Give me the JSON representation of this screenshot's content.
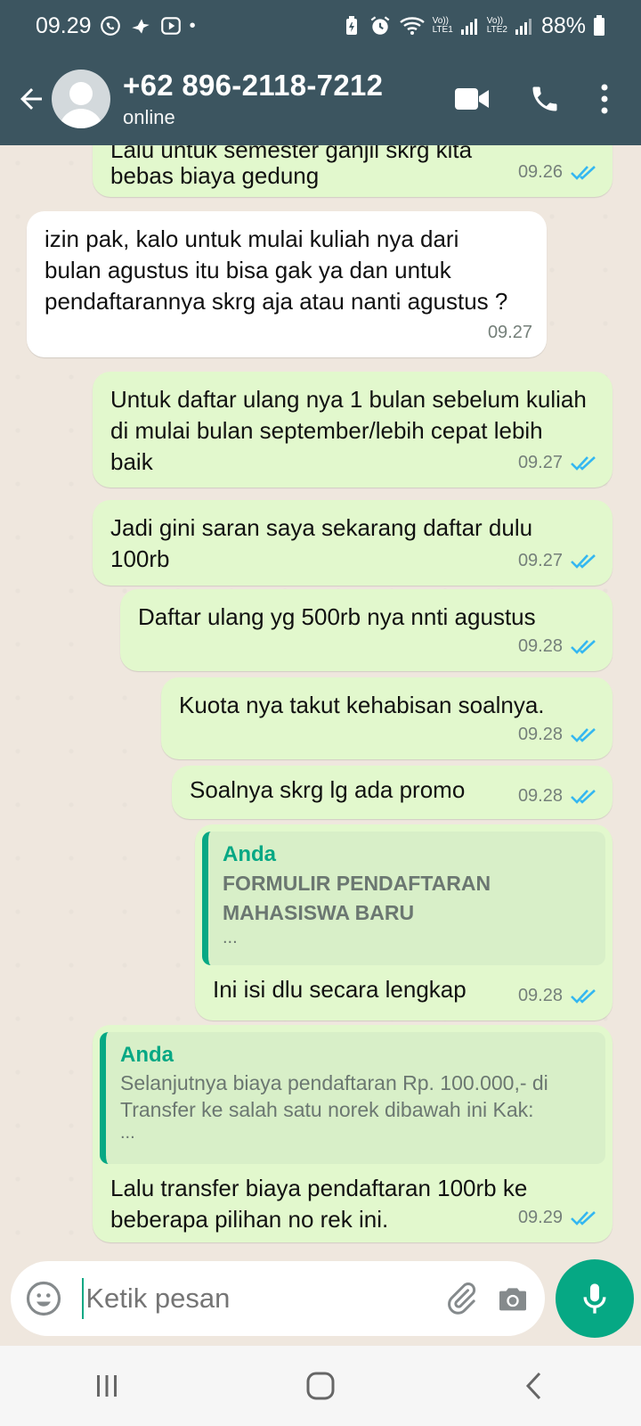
{
  "status_bar": {
    "time": "09.29",
    "battery": "88%",
    "sim1": "LTE1",
    "sim2": "LTE2",
    "volte1": "Vo))",
    "volte2": "Vo))"
  },
  "header": {
    "contact_name": "+62 896-2118-7212",
    "contact_status": "online",
    "icons": [
      "back-arrow-icon",
      "avatar",
      "video-call-icon",
      "phone-icon",
      "more-options-icon"
    ]
  },
  "messages": [
    {
      "direction": "out",
      "text": "Lalu untuk semester ganjil skrg kita",
      "text2": "bebas biaya gedung",
      "time": "09.26",
      "status": "read"
    },
    {
      "direction": "in",
      "text": "izin pak, kalo untuk mulai kuliah nya dari bulan agustus itu bisa gak ya dan untuk pendaftarannya skrg aja atau nanti agustus ?",
      "time": "09.27"
    },
    {
      "direction": "out",
      "text": "Untuk daftar ulang nya 1 bulan sebelum kuliah di mulai bulan september/lebih cepat lebih baik",
      "time": "09.27",
      "status": "read"
    },
    {
      "direction": "out",
      "text": "Jadi gini saran saya sekarang daftar dulu 100rb",
      "time": "09.27",
      "status": "read"
    },
    {
      "direction": "out",
      "text": "Daftar ulang yg 500rb nya nnti agustus",
      "time": "09.28",
      "status": "read"
    },
    {
      "direction": "out",
      "text": "Kuota nya takut kehabisan soalnya.",
      "time": "09.28",
      "status": "read"
    },
    {
      "direction": "out",
      "text": "Soalnya skrg lg ada promo",
      "time": "09.28",
      "status": "read"
    },
    {
      "direction": "out",
      "quote_author": "Anda",
      "quote_title": "FORMULIR PENDAFTARAN MAHASISWA BARU",
      "quote_more": "...",
      "text": "Ini isi dlu secara lengkap",
      "time": "09.28",
      "status": "read"
    },
    {
      "direction": "out",
      "quote_author": "Anda",
      "quote_body": "Selanjutnya biaya pendaftaran Rp. 100.000,- di Transfer ke salah satu norek dibawah ini Kak:",
      "quote_more": "...",
      "text": "Lalu transfer biaya pendaftaran 100rb ke beberapa pilihan no rek ini.",
      "time": "09.29",
      "status": "read"
    }
  ],
  "composer": {
    "placeholder": "Ketik pesan",
    "icons": [
      "emoji-icon",
      "attach-icon",
      "camera-icon",
      "mic-icon"
    ]
  },
  "colors": {
    "header_bg": "#3c5560",
    "accent": "#06a884",
    "out_bubble": "#e2f8cd",
    "in_bubble": "#ffffff",
    "chat_bg": "#efe7de",
    "read_tick": "#34b7f1"
  }
}
